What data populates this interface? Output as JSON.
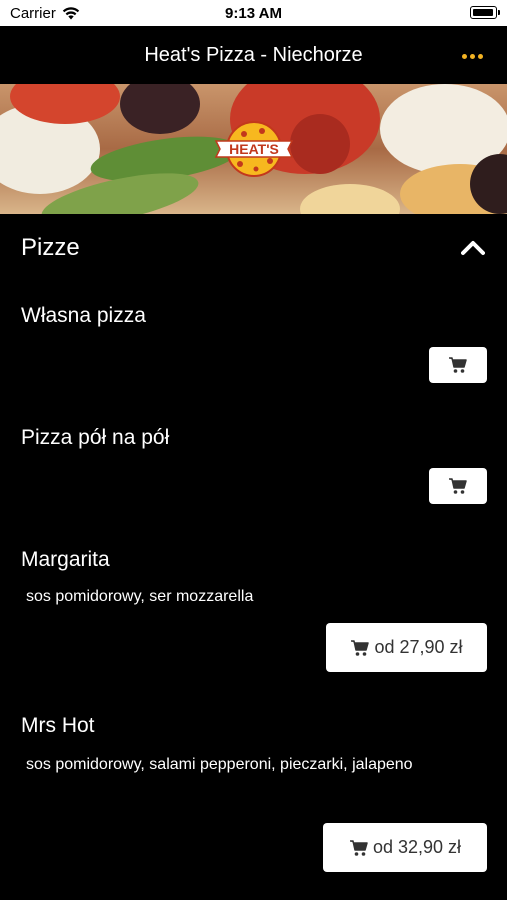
{
  "status_bar": {
    "carrier": "Carrier",
    "time": "9:13 AM"
  },
  "nav": {
    "title": "Heat's Pizza - Niechorze"
  },
  "banner": {
    "logo_text": "HEAT'S"
  },
  "section": {
    "title": "Pizze"
  },
  "items": [
    {
      "name": "Własna pizza",
      "description": "",
      "price_label": ""
    },
    {
      "name": "Pizza pół na pół",
      "description": "",
      "price_label": ""
    },
    {
      "name": "Margarita",
      "description": "sos pomidorowy, ser mozzarella",
      "price_label": "od 27,90 zł"
    },
    {
      "name": "Mrs Hot",
      "description": "sos pomidorowy, salami pepperoni, pieczarki, jalapeno",
      "price_label": "od 32,90 zł"
    }
  ],
  "colors": {
    "accent": "#f3b323",
    "background": "#000000",
    "button_bg": "#ffffff"
  },
  "icons": {
    "menu": "more-dots-icon",
    "collapse": "chevron-up-icon",
    "cart": "cart-icon"
  }
}
